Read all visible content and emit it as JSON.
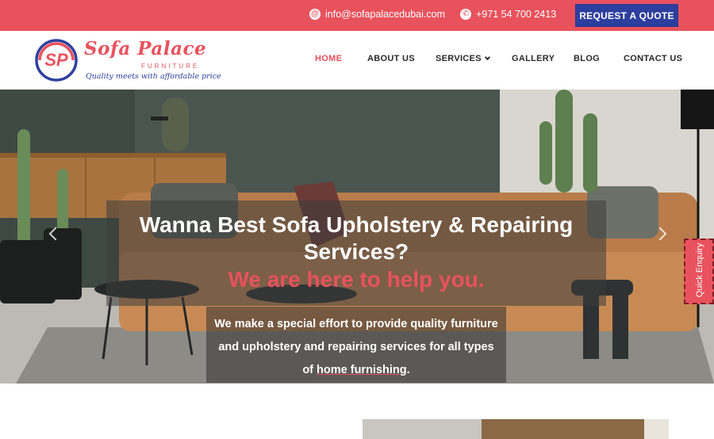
{
  "topbar": {
    "email": "info@sofapalacedubai.com",
    "phone": "+971 54 700 2413",
    "quote_button": "REQUEST A QUOTE"
  },
  "logo": {
    "name": "Sofa Palace",
    "sub": "FURNITURE",
    "tagline": "Quality meets with affordable price",
    "mark": "SP"
  },
  "nav": {
    "home": "HOME",
    "about": "ABOUT US",
    "services": "SERVICES",
    "gallery": "GALLERY",
    "blog": "BLOG",
    "contact": "CONTACT US"
  },
  "hero": {
    "title": "Wanna Best Sofa Upholstery & Repairing Services?",
    "highlight": "We are here to help you.",
    "desc_line1": "We make a special effort to provide quality furniture",
    "desc_line2": "and upholstery and repairing services for all types",
    "desc_line3a": "of ",
    "desc_line3b": "home furnishing",
    "desc_line3c": "."
  },
  "quick_enquiry": "Quick Enquiry",
  "colors": {
    "brand_red": "#e8525d",
    "brand_blue": "#2d3f9e"
  },
  "icons": {
    "email": "at-icon",
    "phone": "phone-icon",
    "services_dropdown": "chevron-down-icon",
    "slider_prev": "chevron-left-icon",
    "slider_next": "chevron-right-icon"
  }
}
